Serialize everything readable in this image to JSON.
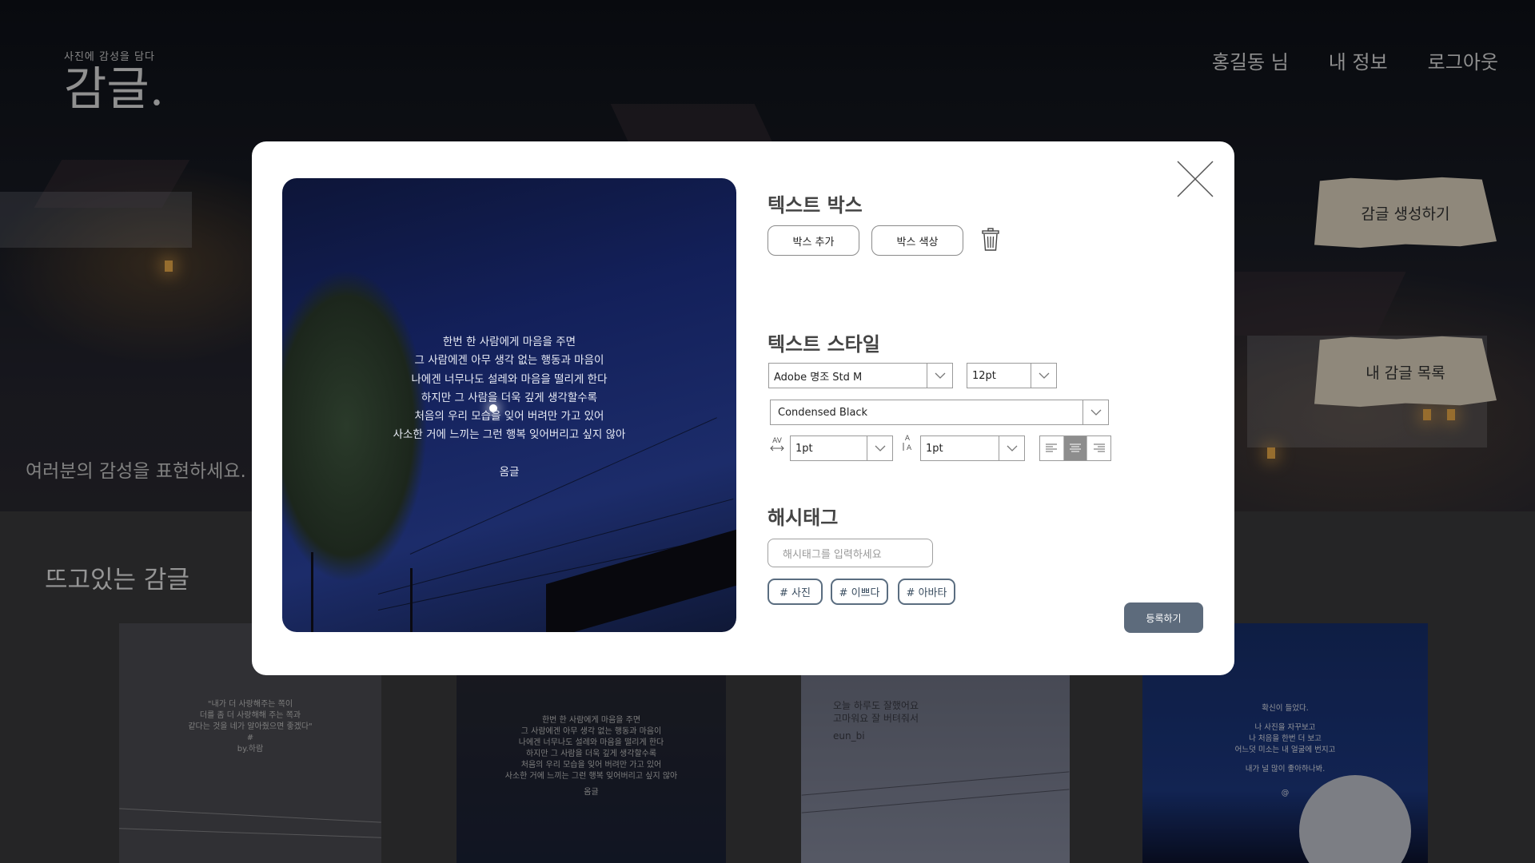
{
  "brand": {
    "tagline": "사진에 감성을 담다",
    "name": "감글."
  },
  "nav": {
    "user": "홍길동 님",
    "profile": "내 정보",
    "logout": "로그아웃"
  },
  "hero": {
    "subtitle": "여러분의 감성을 표현하세요."
  },
  "side_buttons": {
    "create": "감글 생성하기",
    "list": "내 감글 목록"
  },
  "trending": {
    "title": "뜨고있는 감글",
    "cards": [
      {
        "lines": [
          "\"내가 더 사랑해주는 쪽이",
          "더를 좀 더 사랑해해 주는 쪽과",
          "같다는 것을 네가 알아줬으면 좋겠다\"",
          "#",
          "by.하람"
        ]
      },
      {
        "lines": [
          "한번 한 사람에게 마음을 주면",
          "그 사람에겐 아무 생각 없는 행동과 마음이",
          "나에겐 너무나도 설레와 마음을 떨리게 한다",
          "하지만 그 사람을 더욱 깊게 생각할수록",
          "처음의 우리 모습을 잊어 버려만 가고 있어",
          "사소한 거에 느끼는 그런 행복 잊어버리고 싶지 않아"
        ],
        "sig": "옴글"
      },
      {
        "lines": [
          "오늘 하루도 잘했어요",
          "고마워요 잘 버텨줘서"
        ],
        "sig": "eun_bi"
      },
      {
        "lines": [
          "확신이 들었다.",
          "나 사진을 자꾸보고",
          "나 처음을 한번 더 보고",
          "어느덧 미소는 내 얼굴에 번지고",
          "내가 널 많이 좋아하나봐."
        ],
        "sig": "@"
      }
    ]
  },
  "modal": {
    "preview": {
      "lines": [
        "한번 한 사람에게 마음을 주면",
        "그 사람에겐 아무 생각 없는 행동과 마음이",
        "나에겐 너무나도 설레와 마음을 떨리게 한다",
        "하지만 그 사람을 더욱 깊게 생각할수록",
        "처음의 우리 모습을 잊어 버려만 가고 있어",
        "사소한 거에 느끼는 그런 행복 잊어버리고 싶지 않아"
      ],
      "signature": "옴글"
    },
    "textbox": {
      "title": "텍스트 박스",
      "add": "박스 추가",
      "color": "박스 색상"
    },
    "style": {
      "title": "텍스트 스타일",
      "font": "Adobe 명조 Std M",
      "size": "12pt",
      "weight": "Condensed Black",
      "letter_spacing": "1pt",
      "line_spacing": "1pt",
      "letter_icon": "AV",
      "line_icon": "A",
      "alignment_selected": "center"
    },
    "hashtag": {
      "title": "해시태그",
      "placeholder": "해시태그를 입력하세요",
      "tags": [
        "# 사진",
        "# 이쁘다",
        "# 아바타"
      ]
    },
    "submit": "등록하기"
  }
}
